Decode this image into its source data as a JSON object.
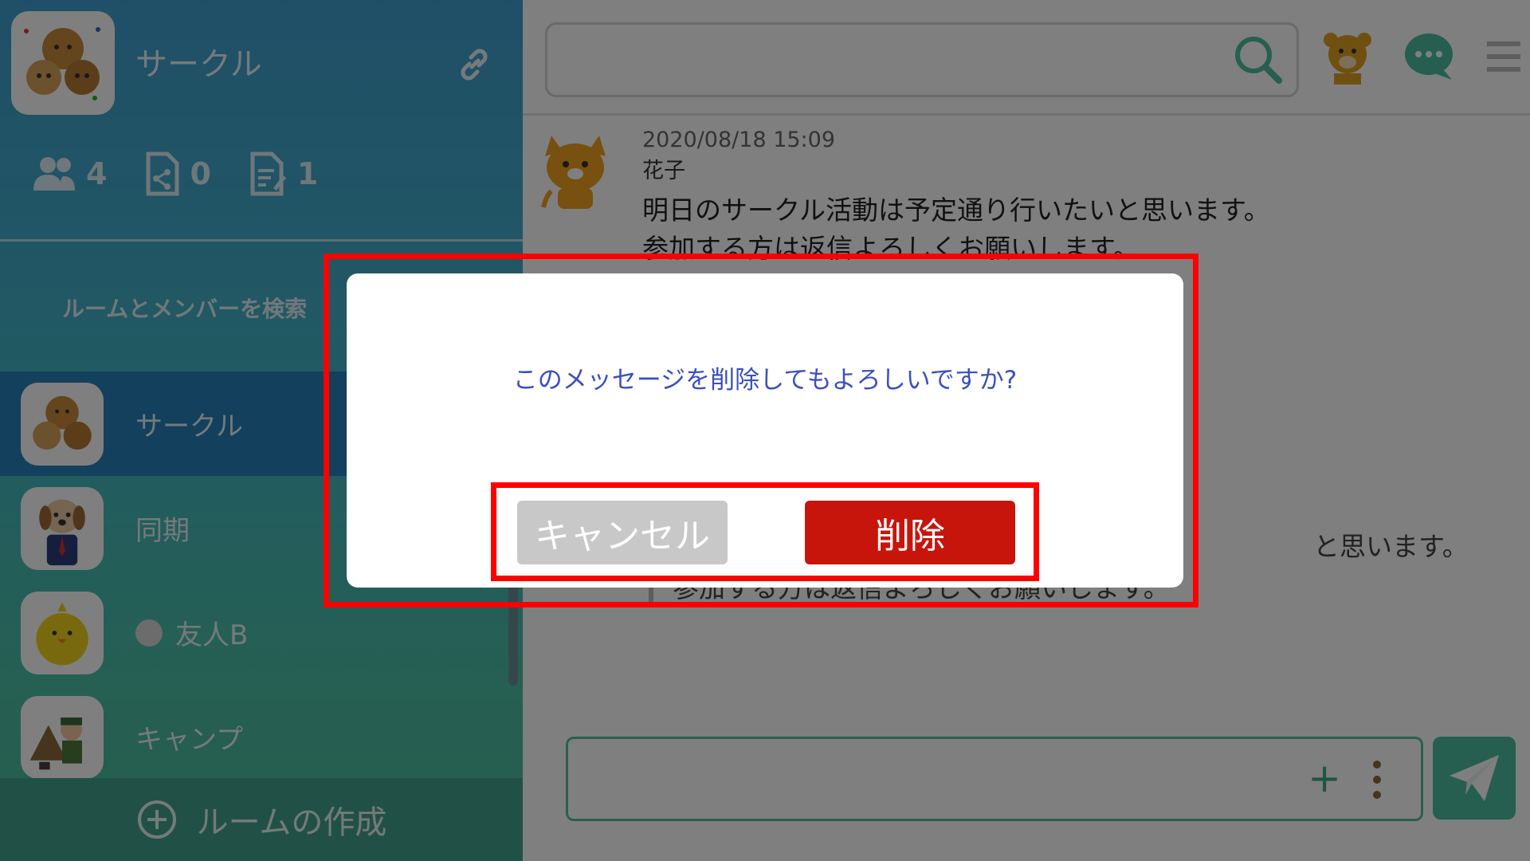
{
  "sidebar": {
    "circle_title": "サークル",
    "stats": {
      "members": "4",
      "files": "0",
      "notes": "1"
    },
    "search_label": "ルームとメンバーを検索",
    "rooms": [
      {
        "label": "サークル",
        "active": true,
        "avatar": "animal-group-avatar"
      },
      {
        "label": "同期",
        "active": false,
        "avatar": "dog-businessman-avatar"
      },
      {
        "label": "友人B",
        "active": false,
        "avatar": "chick-avatar",
        "presence": "offline"
      },
      {
        "label": "キャンプ",
        "active": false,
        "avatar": "camper-avatar"
      }
    ],
    "create_room_label": "ルームの作成"
  },
  "main": {
    "search_placeholder": "",
    "message": {
      "timestamp": "2020/08/18 15:09",
      "author": "花子",
      "line1": "明日のサークル活動は予定通り行いたいと思います。",
      "line2": "参加する方は返信よろしくお願いします。"
    },
    "quoted": {
      "line1_tail": "と思います。",
      "line2": "参加する方は返信よろしくお願いします。"
    },
    "composer_placeholder": ""
  },
  "dialog": {
    "message": "このメッセージを削除してもよろしいですか?",
    "cancel_label": "キャンセル",
    "delete_label": "削除"
  },
  "colors": {
    "accent": "#4dbf9e",
    "delete": "#c8150c",
    "cancel": "#c8c8c8",
    "dialog_text": "#3b4fbf",
    "highlight": "#ff0000"
  }
}
